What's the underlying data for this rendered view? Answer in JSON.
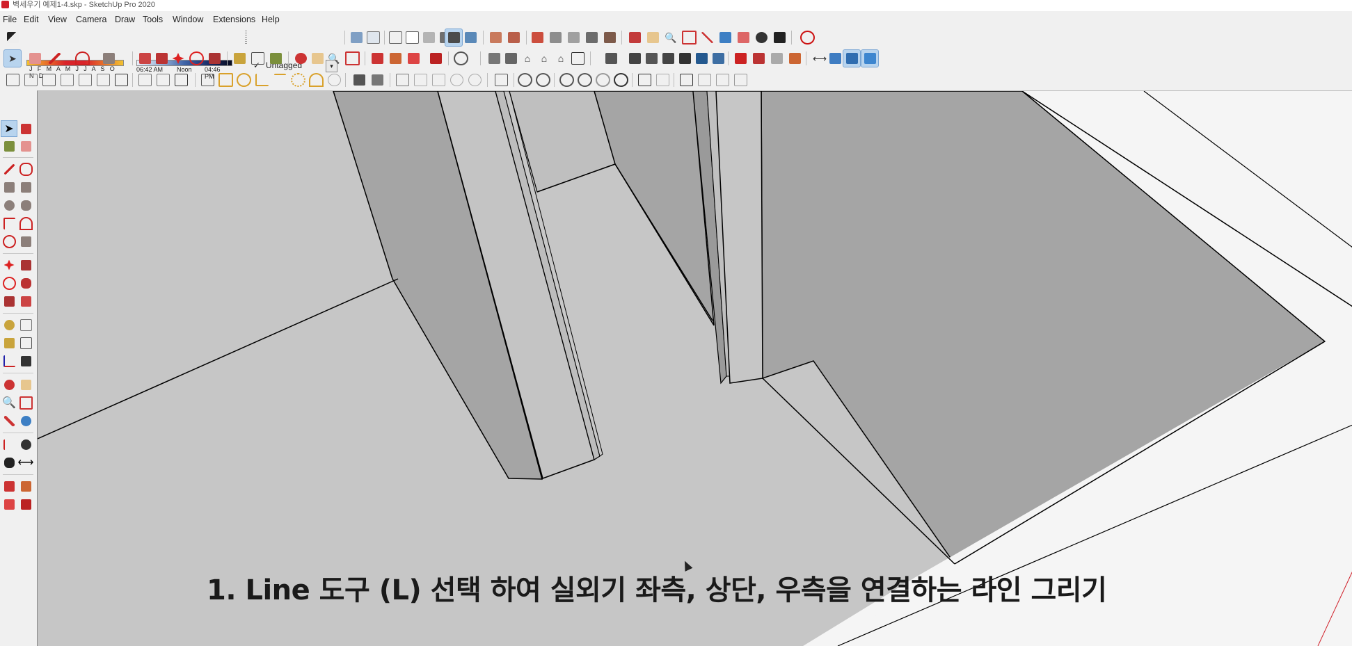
{
  "window": {
    "title": "벽세우기 예제1-4.skp - SketchUp Pro 2020"
  },
  "menu": [
    "File",
    "Edit",
    "View",
    "Camera",
    "Draw",
    "Tools",
    "Window",
    "Extensions",
    "Help"
  ],
  "shadow": {
    "months_label": "J F M A M J J A S O N D",
    "time_start": "06:42 AM",
    "time_noon": "Noon",
    "time_end": "04:46 PM"
  },
  "tag": {
    "check": "✓",
    "current": "Untagged",
    "dropdown_glyph": "▾"
  },
  "caption": "1. Line 도구 (L) 선택 하여 실외기 좌측, 상단, 우측을 연결하는 라인 그리기",
  "colors": {
    "accent_active": "#b8d4ee",
    "viewport_floor": "#c6c6c6",
    "wall_dark": "#a5a5a5",
    "wall_light": "#f5f5f5",
    "edge": "#000000",
    "red_axis": "#d0202a"
  },
  "toolbar_row1_icons": [
    "eraser-icon",
    "shadow-display-icon",
    "face-style-icons",
    "iso-view-icons",
    "sandbox-icons",
    "terrain-icons",
    "section-icon",
    "geolocation-icon"
  ],
  "toolbar_row2_icons": [
    "select-icon",
    "eraser-icon",
    "pencil-icon",
    "arc-icon",
    "rectangle-icon",
    "push-pull-icon",
    "follow-me-icon",
    "move-icon",
    "rotate-icon",
    "offset-icon",
    "tape-icon",
    "text-icon",
    "paint-icon",
    "orbit-icon",
    "pan-icon",
    "zoom-icon",
    "zoom-extents-icon",
    "warehouse-icons",
    "style-icons",
    "axes-icon"
  ],
  "toolbar_row3_icons": [
    "view-icons",
    "style-icons",
    "section-icons",
    "solid-tools-icons",
    "lock-icon"
  ]
}
